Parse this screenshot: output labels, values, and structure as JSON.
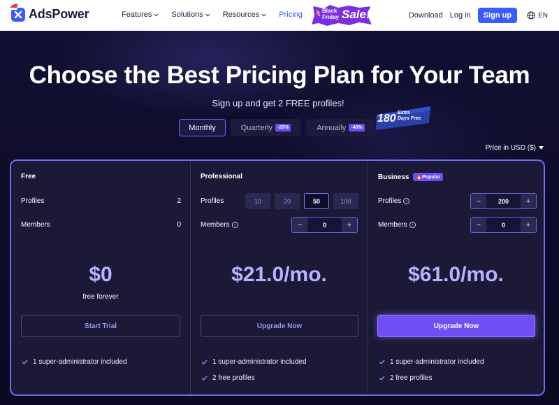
{
  "nav": {
    "brand": "AdsPower",
    "links": [
      {
        "label": "Features",
        "dropdown": true
      },
      {
        "label": "Solutions",
        "dropdown": true
      },
      {
        "label": "Resources",
        "dropdown": true
      },
      {
        "label": "Pricing",
        "dropdown": false,
        "active": true
      }
    ],
    "promo": {
      "line1": "Black",
      "line2": "Friday",
      "word": "Sale",
      "suffix": "!"
    },
    "download": "Download",
    "login": "Log in",
    "signup": "Sign up",
    "lang": "EN"
  },
  "hero": {
    "title": "Choose the Best Pricing Plan for Your Team",
    "subtitle": "Sign up and get 2 FREE profiles!"
  },
  "billing": {
    "tabs": [
      {
        "label": "Monthly",
        "discount": "",
        "active": true
      },
      {
        "label": "Quarterly",
        "discount": "-20%",
        "active": false
      },
      {
        "label": "Annually",
        "discount": "-40%",
        "active": false
      }
    ],
    "extra": {
      "number": "180",
      "line1": "Extra",
      "line2": "Days Free"
    }
  },
  "currency": "Price in USD ($)",
  "plans": [
    {
      "name": "Free",
      "profiles_label": "Profiles",
      "profiles_value": "2",
      "members_label": "Members",
      "members_value": "0",
      "price": "$0",
      "price_note": "free forever",
      "cta": "Start Trial",
      "features": [
        "1 super-administrator included"
      ]
    },
    {
      "name": "Professional",
      "profiles_label": "Profiles",
      "profile_options": [
        "10",
        "20",
        "50",
        "100"
      ],
      "selected_option": "50",
      "members_label": "Members",
      "members_value": "0",
      "price": "$21.0/mo.",
      "cta": "Upgrade Now",
      "features": [
        "1 super-administrator included",
        "2 free profiles"
      ]
    },
    {
      "name": "Business",
      "badge": "🔥Popular",
      "profiles_label": "Profiles",
      "profiles_value": "200",
      "members_label": "Members",
      "members_value": "0",
      "price": "$61.0/mo.",
      "cta": "Upgrade Now",
      "features": [
        "1 super-administrator included",
        "2 free profiles"
      ]
    }
  ],
  "colors": {
    "accent": "#3b5bfd",
    "purple": "#6f4ef4",
    "price": "#b7b2ff",
    "background": "#0d0b24"
  }
}
